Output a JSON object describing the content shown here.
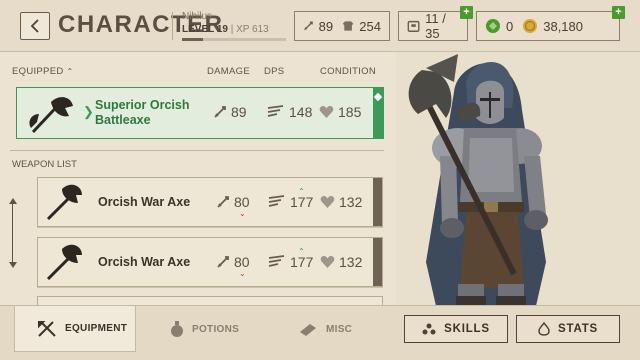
{
  "header": {
    "title": "CHARACTER",
    "player_name": "Nihilus",
    "level_label": "LEVEL 19",
    "xp_label": "| XP 613",
    "xp_progress": 0.2,
    "attack": "89",
    "armor": "254",
    "inventory": "11 / 35",
    "gems": "0",
    "gold": "38,180"
  },
  "columns": {
    "equipped": "EQUIPPED",
    "damage": "DAMAGE",
    "dps": "DPS",
    "condition": "CONDITION"
  },
  "equipped_item": {
    "name": "Superior Orcish Battleaxe",
    "damage": "89",
    "dps": "148",
    "condition": "185"
  },
  "weapon_list_label": "WEAPON LIST",
  "weapon_list": [
    {
      "name": "Orcish War Axe",
      "damage": "80",
      "dps": "177",
      "condition": "132"
    },
    {
      "name": "Orcish War Axe",
      "damage": "80",
      "dps": "177",
      "condition": "132"
    }
  ],
  "tabs": {
    "equipment": "EQUIPMENT",
    "potions": "POTIONS",
    "misc": "MISC"
  },
  "buttons": {
    "skills": "SKILLS",
    "stats": "STATS"
  },
  "colors": {
    "accent_green": "#3b9a55",
    "background": "#ece3d2",
    "text": "#3b3228"
  }
}
